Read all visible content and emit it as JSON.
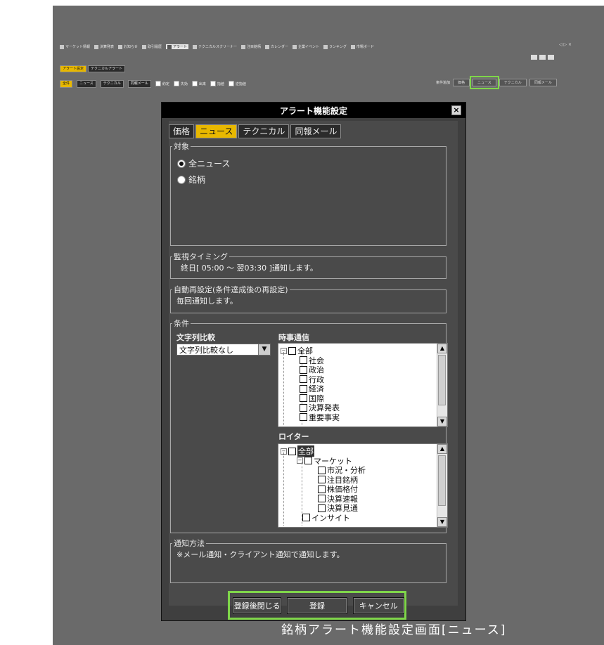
{
  "toolbar": {
    "items": [
      "マーケット情報",
      "決算発表",
      "お知らせ",
      "取引履歴",
      "アラート",
      "テクニカルスクリーナー",
      "注目銘柄",
      "カレンダー",
      "企業イベント",
      "ランキング",
      "市場ボード"
    ],
    "active_index": 4,
    "right_text": "◁ ▷ ×"
  },
  "subtabs": [
    "アラート設定",
    "テクニカルアラート"
  ],
  "filter_chips": [
    "全件",
    "ニュース",
    "テクニカル",
    "同報メール"
  ],
  "filter_checks": [
    "約定",
    "失効",
    "出来",
    "指値",
    "逆指値"
  ],
  "right_buttons": {
    "label": "条件追加",
    "buttons": [
      "価格",
      "ニュース",
      "テクニカル",
      "同報メール"
    ],
    "highlight_index": 1
  },
  "dialog": {
    "title": "アラート機能設定",
    "close": "×",
    "tabs": [
      "価格",
      "ニュース",
      "テクニカル",
      "同報メール"
    ],
    "selected_tab": 1,
    "target": {
      "legend": "対象",
      "options": [
        "全ニュース",
        "銘柄"
      ],
      "selected": 0
    },
    "timing": {
      "legend": "監視タイミング",
      "text": "終日[ 05:00 ～ 翌03:30 ]通知します。"
    },
    "reset": {
      "legend": "自動再設定(条件達成後の再設定)",
      "text": "毎回通知します。"
    },
    "conditions": {
      "legend": "条件",
      "string_compare_label": "文字列比較",
      "string_compare_value": "文字列比較なし",
      "jiji_label": "時事通信",
      "jiji_tree": [
        "全部",
        "社会",
        "政治",
        "行政",
        "経済",
        "国際",
        "決算発表",
        "重要事実"
      ],
      "reuters_label": "ロイター",
      "reuters_tree": [
        "全部",
        "マーケット",
        "市況・分析",
        "注目銘柄",
        "株価格付",
        "決算速報",
        "決算見通",
        "インサイト"
      ]
    },
    "notify": {
      "legend": "通知方法",
      "text": "※メール通知・クライアント通知で通知します。"
    },
    "buttons": [
      "登録後閉じる",
      "登録",
      "キャンセル"
    ]
  },
  "caption": "銘柄アラート機能設定画面[ニュース]",
  "colors": {
    "highlight": "#7fd64a",
    "tab_selected": "#e8b800"
  }
}
